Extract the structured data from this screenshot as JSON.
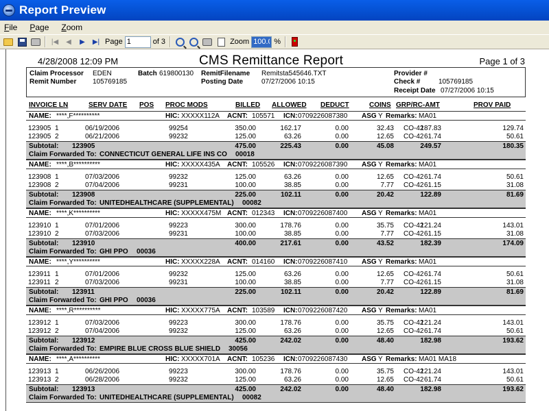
{
  "window": {
    "title": "Report Preview"
  },
  "menu": [
    "File",
    "Page",
    "Zoom"
  ],
  "toolbar": {
    "page_label": "Page",
    "page_value": "1",
    "page_of": "of 3",
    "zoom_label": "Zoom",
    "zoom_value": "100.0",
    "zoom_unit": "%"
  },
  "report": {
    "date": "4/28/2008 12:09 PM",
    "title": "CMS Remittance Report",
    "page_info": "Page  1  of  3",
    "header": {
      "claim_processor_label": "Claim Processor",
      "claim_processor": "EDEN",
      "batch_label": "Batch",
      "batch": "619800130",
      "remit_filename_label": "RemitFilename",
      "remit_filename": "Remitsta545646.TXT",
      "provider_label": "Provider #",
      "remit_number_label": "Remit Number",
      "remit_number": "105769185",
      "posting_date_label": "Posting Date",
      "posting_date": "07/27/2006  10:15",
      "check_label": "Check  #",
      "check": "105769185",
      "receipt_date_label": "Receipt Date",
      "receipt_date": "07/27/2006  10:15"
    },
    "columns": [
      "INVOICE LN",
      "SERV DATE",
      "POS",
      "PROC MODS",
      "BILLED",
      "ALLOWED",
      "DEDUCT",
      "COINS",
      "GRP/RC-AMT",
      "PROV PAID"
    ],
    "claims": [
      {
        "name": "****,F**********",
        "hic": "XXXXX112A",
        "acnt": "105571",
        "icn": "0709226087380",
        "asg": "Y",
        "remarks": "MA01",
        "lines": [
          {
            "inv": "123905",
            "ln": "1",
            "date": "06/19/2006",
            "proc": "99254",
            "billed": "350.00",
            "allowed": "162.17",
            "deduct": "0.00",
            "coins": "32.43",
            "grp": "187.83",
            "code": "CO-42",
            "paid": "129.74"
          },
          {
            "inv": "123905",
            "ln": "2",
            "date": "06/21/2006",
            "proc": "99232",
            "billed": "125.00",
            "allowed": "63.26",
            "deduct": "0.00",
            "coins": "12.65",
            "grp": "61.74",
            "code": "CO-42",
            "paid": "50.61"
          }
        ],
        "subtotal": {
          "inv": "123905",
          "billed": "475.00",
          "allowed": "225.43",
          "deduct": "0.00",
          "coins": "45.08",
          "grp": "249.57",
          "paid": "180.35"
        },
        "forwarded": "CONNECTICUT GENERAL LIFE INS CO",
        "forwarded_code": "00018"
      },
      {
        "name": "****,B**********",
        "hic": "XXXXX435A",
        "acnt": "105526",
        "icn": "0709226087390",
        "asg": "Y",
        "remarks": "MA01",
        "lines": [
          {
            "inv": "123908",
            "ln": "1",
            "date": "07/03/2006",
            "proc": "99232",
            "billed": "125.00",
            "allowed": "63.26",
            "deduct": "0.00",
            "coins": "12.65",
            "grp": "61.74",
            "code": "CO-42",
            "paid": "50.61"
          },
          {
            "inv": "123908",
            "ln": "2",
            "date": "07/04/2006",
            "proc": "99231",
            "billed": "100.00",
            "allowed": "38.85",
            "deduct": "0.00",
            "coins": "7.77",
            "grp": "61.15",
            "code": "CO-42",
            "paid": "31.08"
          }
        ],
        "subtotal": {
          "inv": "123908",
          "billed": "225.00",
          "allowed": "102.11",
          "deduct": "0.00",
          "coins": "20.42",
          "grp": "122.89",
          "paid": "81.69"
        },
        "forwarded": "UNITEDHEALTHCARE  (SUPPLEMENTAL)",
        "forwarded_code": "00082"
      },
      {
        "name": "****,K**********",
        "hic": "XXXXX475M",
        "acnt": "012343",
        "icn": "0709226087400",
        "asg": "Y",
        "remarks": "MA01",
        "lines": [
          {
            "inv": "123910",
            "ln": "1",
            "date": "07/01/2006",
            "proc": "99223",
            "billed": "300.00",
            "allowed": "178.76",
            "deduct": "0.00",
            "coins": "35.75",
            "grp": "121.24",
            "code": "CO-42",
            "paid": "143.01"
          },
          {
            "inv": "123910",
            "ln": "2",
            "date": "07/03/2006",
            "proc": "99231",
            "billed": "100.00",
            "allowed": "38.85",
            "deduct": "0.00",
            "coins": "7.77",
            "grp": "61.15",
            "code": "CO-42",
            "paid": "31.08"
          }
        ],
        "subtotal": {
          "inv": "123910",
          "billed": "400.00",
          "allowed": "217.61",
          "deduct": "0.00",
          "coins": "43.52",
          "grp": "182.39",
          "paid": "174.09"
        },
        "forwarded": "GHI PPO",
        "forwarded_code": "00036"
      },
      {
        "name": "****,Y**********",
        "hic": "XXXXX228A",
        "acnt": "014160",
        "icn": "0709226087410",
        "asg": "Y",
        "remarks": "MA01",
        "lines": [
          {
            "inv": "123911",
            "ln": "1",
            "date": "07/01/2006",
            "proc": "99232",
            "billed": "125.00",
            "allowed": "63.26",
            "deduct": "0.00",
            "coins": "12.65",
            "grp": "61.74",
            "code": "CO-42",
            "paid": "50.61"
          },
          {
            "inv": "123911",
            "ln": "2",
            "date": "07/03/2006",
            "proc": "99231",
            "billed": "100.00",
            "allowed": "38.85",
            "deduct": "0.00",
            "coins": "7.77",
            "grp": "61.15",
            "code": "CO-42",
            "paid": "31.08"
          }
        ],
        "subtotal": {
          "inv": "123911",
          "billed": "225.00",
          "allowed": "102.11",
          "deduct": "0.00",
          "coins": "20.42",
          "grp": "122.89",
          "paid": "81.69"
        },
        "forwarded": "GHI PPO",
        "forwarded_code": "00036"
      },
      {
        "name": "****,R**********",
        "hic": "XXXXX775A",
        "acnt": "103589",
        "icn": "0709226087420",
        "asg": "Y",
        "remarks": "MA01",
        "lines": [
          {
            "inv": "123912",
            "ln": "1",
            "date": "07/03/2006",
            "proc": "99223",
            "billed": "300.00",
            "allowed": "178.76",
            "deduct": "0.00",
            "coins": "35.75",
            "grp": "121.24",
            "code": "CO-42",
            "paid": "143.01"
          },
          {
            "inv": "123912",
            "ln": "2",
            "date": "07/04/2006",
            "proc": "99232",
            "billed": "125.00",
            "allowed": "63.26",
            "deduct": "0.00",
            "coins": "12.65",
            "grp": "61.74",
            "code": "CO-42",
            "paid": "50.61"
          }
        ],
        "subtotal": {
          "inv": "123912",
          "billed": "425.00",
          "allowed": "242.02",
          "deduct": "0.00",
          "coins": "48.40",
          "grp": "182.98",
          "paid": "193.62"
        },
        "forwarded": "EMPIRE BLUE CROSS BLUE SHIELD",
        "forwarded_code": "30056"
      },
      {
        "name": "****,A**********",
        "hic": "XXXXX701A",
        "acnt": "105236",
        "icn": "0709226087430",
        "asg": "Y",
        "remarks": "MA01  MA18",
        "lines": [
          {
            "inv": "123913",
            "ln": "1",
            "date": "06/26/2006",
            "proc": "99223",
            "billed": "300.00",
            "allowed": "178.76",
            "deduct": "0.00",
            "coins": "35.75",
            "grp": "121.24",
            "code": "CO-42",
            "paid": "143.01"
          },
          {
            "inv": "123913",
            "ln": "2",
            "date": "06/28/2006",
            "proc": "99232",
            "billed": "125.00",
            "allowed": "63.26",
            "deduct": "0.00",
            "coins": "12.65",
            "grp": "61.74",
            "code": "CO-42",
            "paid": "50.61"
          }
        ],
        "subtotal": {
          "inv": "123913",
          "billed": "425.00",
          "allowed": "242.02",
          "deduct": "0.00",
          "coins": "48.40",
          "grp": "182.98",
          "paid": "193.62"
        },
        "forwarded": "UNITEDHEALTHCARE  (SUPPLEMENTAL)",
        "forwarded_code": "00082"
      }
    ],
    "labels": {
      "name": "NAME:",
      "hic": "HIC:",
      "acnt": "ACNT:",
      "icn": "ICN:",
      "asg": "ASG",
      "remarks": "Remarks:",
      "subtotal": "Subtotal:",
      "forwarded": "Claim Forwarded To:"
    }
  }
}
